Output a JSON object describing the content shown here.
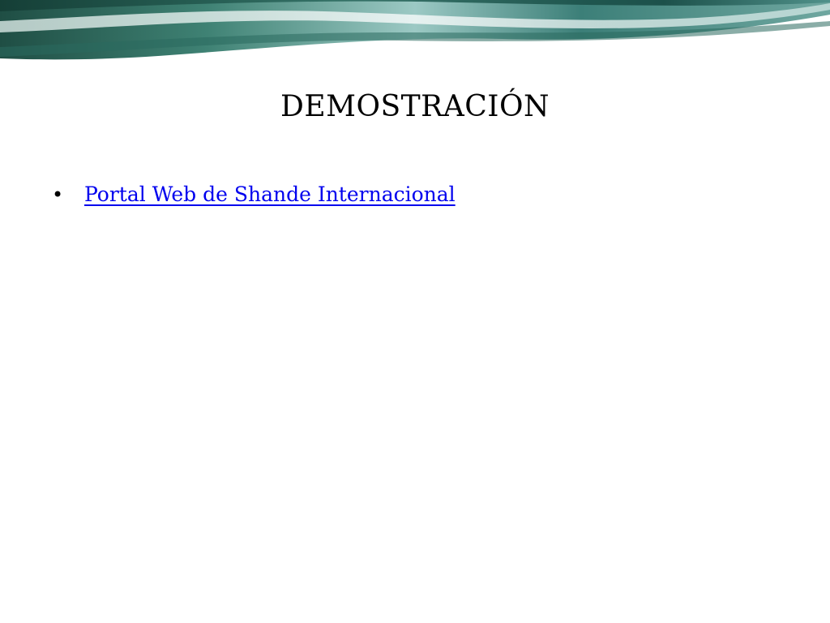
{
  "slide": {
    "title": "DEMOSTRACIÓN",
    "bullets": [
      {
        "symbol": "•",
        "link_text": "Portal Web de Shande Internacional"
      }
    ]
  },
  "colors": {
    "link": "#0000ee",
    "banner_dark": "#1f5a4e",
    "banner_mid": "#5f9a90",
    "banner_light": "#dcefee"
  }
}
